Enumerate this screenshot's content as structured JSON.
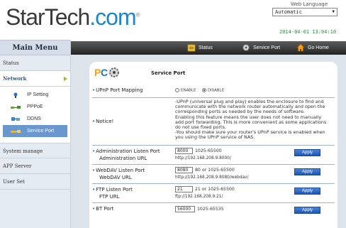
{
  "header": {
    "logo_part1": "StarTech",
    "logo_part2": ".com",
    "logo_tm": "®",
    "web_language_label": "Web Language",
    "language_value": "Automatic",
    "datetime": "2014-04-01 13:04:10"
  },
  "sidebar": {
    "title": "Main Menu",
    "items": [
      {
        "label": "Status"
      },
      {
        "label": "Network"
      },
      {
        "label": "System manage"
      },
      {
        "label": "APP Server"
      },
      {
        "label": "User Set"
      }
    ],
    "network_sub": [
      {
        "label": "IP Setting",
        "icon": "network-icon"
      },
      {
        "label": "PPPoE",
        "icon": "pppoe-icon"
      },
      {
        "label": "DDNS",
        "icon": "ddns-icon"
      },
      {
        "label": "Service Port",
        "icon": "service-port-icon"
      }
    ]
  },
  "navbar": {
    "status_label": "Status",
    "service_port_label": "Service Port",
    "go_home_label": "Go Home"
  },
  "panel": {
    "title": "Service Port",
    "upnp": {
      "label": "UPnP Port Mapping",
      "enable_label": "ENABLE",
      "disable_label": "DISABLE",
      "selected": "DISABLE"
    },
    "notice": {
      "label": "Notice!",
      "lines": [
        "-UPnP (universal plug and play) enables the enclosure to find and",
        "communicate with the network router automatically and open the",
        "corresponding ports as needed by the needs of software.",
        "Enabling this feature means the user does not need to manually",
        "add port forwarding. This is more convenient as some applications",
        "do not use fixed ports.",
        "-You should make sure your router's UPnP service is enabled when",
        "you using the UPnP service of NAS."
      ]
    },
    "admin": {
      "label": "Administration Listen Port",
      "sub_label": "Administration URL",
      "port": "8000",
      "range": "1025-65500",
      "url": "http://192.168.208.9:8000/",
      "apply": "Apply"
    },
    "webdav": {
      "label": "WebDAV Listen Port",
      "sub_label": "WebDAV URL",
      "port": "8080",
      "range": "80 or 1025-65500",
      "url": "http://192.168.208.9:8080/webdav/",
      "apply": "Apply"
    },
    "ftp": {
      "label": "FTP Listen Port",
      "sub_label": "FTP URL",
      "port": "21",
      "range": "21 or 1025-65500",
      "url": "ftp://192.168.208.9:21/",
      "apply": "Apply"
    },
    "bt": {
      "label": "BT Port",
      "port": "56000",
      "range": "1025-65535",
      "apply": "Apply"
    }
  },
  "colors": {
    "brand_blue": "#1d86c8",
    "accent_green": "#2e8b45",
    "apply_blue": "#1c56b8",
    "selected_item": "#6b97cf"
  }
}
